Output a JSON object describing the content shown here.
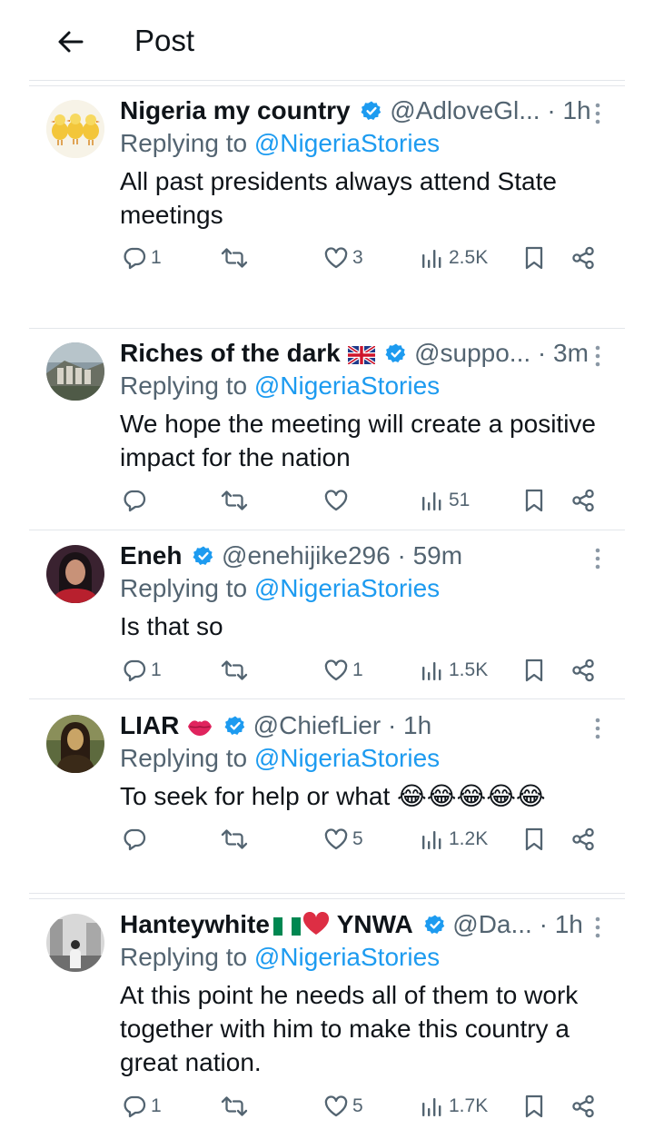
{
  "header": {
    "title": "Post"
  },
  "tweets": [
    {
      "name": "Nigeria my country",
      "handle": "@AdloveGl...",
      "time": "· 1h",
      "replying_prefix": "Replying to ",
      "replying_to": "@NigeriaStories",
      "text": "All past presidents always attend State meetings",
      "replies": "1",
      "retweets": "",
      "likes": "3",
      "views": "2.5K"
    },
    {
      "name": "Riches of the dark",
      "handle": "@suppo...",
      "time": "· 3m",
      "replying_prefix": "Replying to ",
      "replying_to": "@NigeriaStories",
      "text": "We hope the meeting will create a positive impact for the nation",
      "replies": "",
      "retweets": "",
      "likes": "",
      "views": "51"
    },
    {
      "name": "Eneh",
      "handle": "@enehijike296",
      "time": "· 59m",
      "replying_prefix": "Replying to ",
      "replying_to": "@NigeriaStories",
      "text": "Is that so",
      "replies": "1",
      "retweets": "",
      "likes": "1",
      "views": "1.5K"
    },
    {
      "name": "LIAR",
      "handle": "@ChiefLier",
      "time": "· 1h",
      "replying_prefix": "Replying to ",
      "replying_to": "@NigeriaStories",
      "text": "To seek for help or what 😂😂😂😂😂",
      "replies": "",
      "retweets": "",
      "likes": "5",
      "views": "1.2K"
    },
    {
      "name": "Hanteywhite",
      "name_suffix": "YNWA",
      "handle": "@Da...",
      "time": "· 1h",
      "replying_prefix": "Replying to ",
      "replying_to": "@NigeriaStories",
      "text": "At this point he needs all of them to work together with him to make this country a great nation.",
      "replies": "1",
      "retweets": "",
      "likes": "5",
      "views": "1.7K"
    }
  ],
  "colors": {
    "accent": "#1d9bf0",
    "secondary_text": "#536471",
    "divider": "#e3e6ea"
  }
}
